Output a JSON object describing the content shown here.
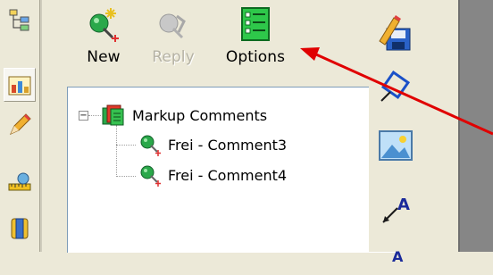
{
  "toolbar": {
    "new_label": "New",
    "reply_label": "Reply",
    "options_label": "Options"
  },
  "tree": {
    "root_label": "Markup Comments",
    "root_expander": "−",
    "items": [
      {
        "label": "Frei - Comment3"
      },
      {
        "label": "Frei - Comment4"
      }
    ]
  },
  "icons": {
    "left_toolbar": [
      "tree-icon",
      "chart-icon",
      "pencil-icon",
      "measure-icon",
      "spool-icon"
    ],
    "right_toolbar": [
      "save-markup-icon",
      "rotate-icon",
      "image-icon",
      "text-arrow-icon"
    ]
  },
  "colors": {
    "annotation_arrow": "#e00000",
    "tree_border": "#7f9db9"
  }
}
